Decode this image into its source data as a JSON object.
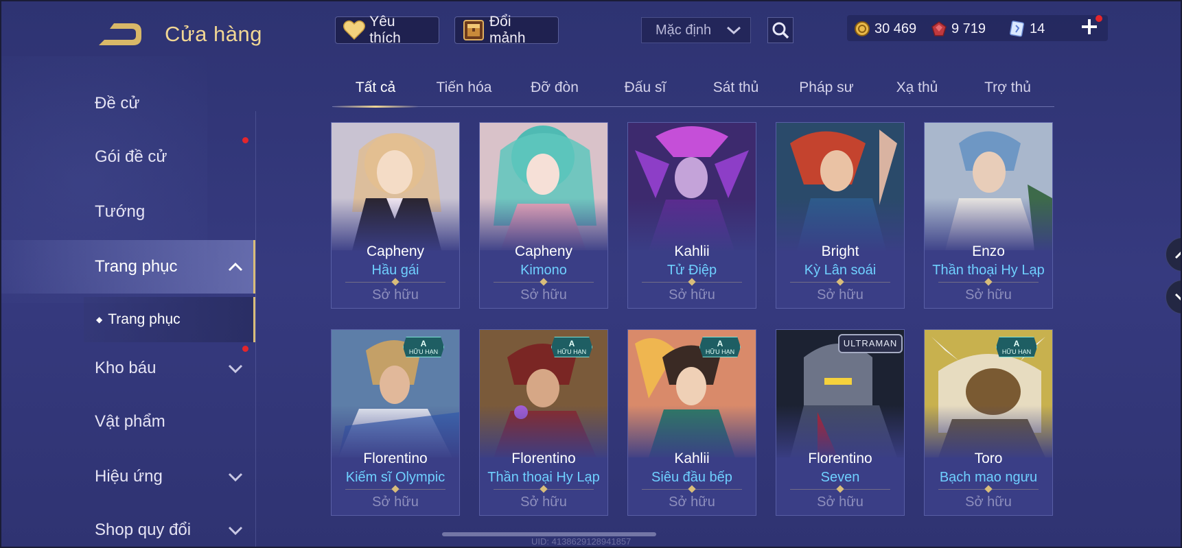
{
  "header": {
    "title": "Cửa hàng",
    "favorites_label": "Yêu thích",
    "exchange_label": "Đổi mảnh",
    "sort_value": "Mặc định"
  },
  "currency": {
    "gold": "30 469",
    "gems": "9 719",
    "vouchers": "14"
  },
  "sidebar": {
    "items": [
      {
        "label": "Đề cử"
      },
      {
        "label": "Gói đề cử"
      },
      {
        "label": "Tướng"
      },
      {
        "label": "Trang phục"
      },
      {
        "label": "Kho báu"
      },
      {
        "label": "Vật phẩm"
      },
      {
        "label": "Hiệu ứng"
      },
      {
        "label": "Shop quy đổi"
      }
    ],
    "sub_item": "Trang phục"
  },
  "tabs": [
    {
      "label": "Tất cả"
    },
    {
      "label": "Tiến hóa"
    },
    {
      "label": "Đỡ đòn"
    },
    {
      "label": "Đấu sĩ"
    },
    {
      "label": "Sát thủ"
    },
    {
      "label": "Pháp sư"
    },
    {
      "label": "Xạ thủ"
    },
    {
      "label": "Trợ thủ"
    }
  ],
  "cards": [
    {
      "hero": "Capheny",
      "skin": "Hầu gái",
      "status": "Sở hữu"
    },
    {
      "hero": "Capheny",
      "skin": "Kimono",
      "status": "Sở hữu"
    },
    {
      "hero": "Kahlii",
      "skin": "Tử Điệp",
      "status": "Sở hữu"
    },
    {
      "hero": "Bright",
      "skin": "Kỳ Lân soái",
      "status": "Sở hữu"
    },
    {
      "hero": "Enzo",
      "skin": "Thần thoại Hy Lạp",
      "status": "Sở hữu"
    },
    {
      "hero": "Florentino",
      "skin": "Kiếm sĩ Olympic",
      "status": "Sở hữu",
      "badge_tier": "A",
      "badge_text": "HỮU HẠN"
    },
    {
      "hero": "Florentino",
      "skin": "Thần thoại Hy Lạp",
      "status": "Sở hữu",
      "badge_tier": "A",
      "badge_text": "HỮU HẠN"
    },
    {
      "hero": "Kahlii",
      "skin": "Siêu đầu bếp",
      "status": "Sở hữu",
      "badge_tier": "A",
      "badge_text": "HỮU HẠN"
    },
    {
      "hero": "Florentino",
      "skin": "Seven",
      "status": "Sở hữu",
      "badge_text": "ULTRAMAN"
    },
    {
      "hero": "Toro",
      "skin": "Bạch mao ngưu",
      "status": "Sở hữu",
      "badge_tier": "A",
      "badge_text": "HỮU HẠN"
    }
  ],
  "footer": {
    "uid": "UID: 4138629128941857"
  },
  "colors": {
    "accent_gold": "#f1d794",
    "skin_name_blue": "#6fd0ff",
    "background": "#2e3372",
    "notification_red": "#e4262c"
  }
}
